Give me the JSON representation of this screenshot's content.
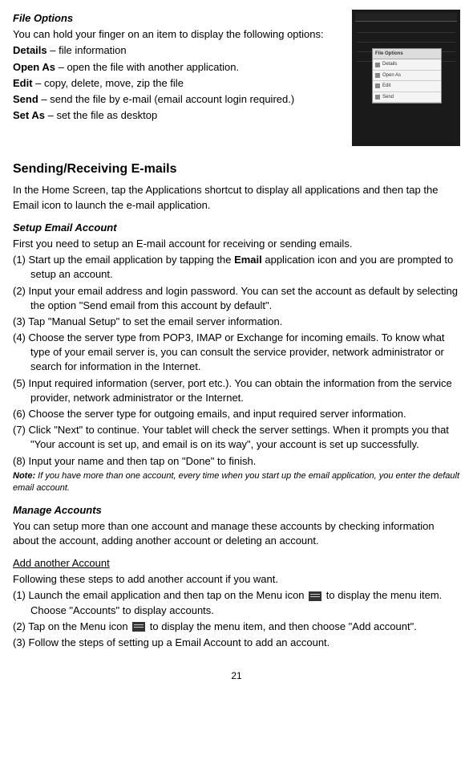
{
  "file_options": {
    "title": "File Options",
    "intro": "You can hold your finger on an item to display the following options:",
    "items": [
      {
        "term": "Details",
        "desc": " – file information"
      },
      {
        "term": "Open As",
        "desc": " – open the file with another application."
      },
      {
        "term": "Edit",
        "desc": " – copy, delete, move, zip the file"
      },
      {
        "term": "Send",
        "desc": " – send the file by e-mail (email account login required.)"
      },
      {
        "term": "Set As",
        "desc": " – set the file as desktop"
      }
    ]
  },
  "screenshot_popup": {
    "title": "File Options",
    "items": [
      "Details",
      "Open As",
      "Edit",
      "Send"
    ]
  },
  "sending": {
    "heading": "Sending/Receiving E-mails",
    "intro": "In the Home Screen, tap the Applications shortcut to display all applications and then tap the Email icon to launch the e-mail application."
  },
  "setup_email": {
    "title": "Setup Email Account",
    "intro": "First you need to setup an E-mail account for receiving or sending emails.",
    "steps": [
      {
        "prefix": "(1) Start up the email application by tapping the ",
        "bold": "Email",
        "suffix": " application icon and you are prompted to setup an account."
      },
      {
        "text": "(2) Input your email address and login password. You can set the account as default by selecting the option \"Send email from this account by default\"."
      },
      {
        "text": "(3) Tap \"Manual Setup\" to set the email server information."
      },
      {
        "text": "(4) Choose the server type from POP3, IMAP or Exchange for incoming emails. To know what type of your email server is, you can consult the service provider, network administrator or search for information in the Internet."
      },
      {
        "text": "(5) Input required information (server, port etc.). You can obtain the information from the service provider, network administrator or the Internet."
      },
      {
        "text": "(6) Choose the server type for outgoing emails, and input required server information."
      },
      {
        "text": "(7) Click \"Next\" to continue. Your tablet will check the server settings. When it prompts you that \"Your account is set up, and email is on its way\", your account is set up successfully."
      },
      {
        "text": "(8) Input your name and then tap on \"Done\" to finish."
      }
    ],
    "note_label": "Note:",
    "note_body": " If you have more than one account, every time when you start up the email application, you enter the default email account."
  },
  "manage_accounts": {
    "title": "Manage Accounts",
    "intro": "You can setup more than one account and manage these accounts by checking information about the account, adding another account or deleting an account."
  },
  "add_account": {
    "title": "Add another Account",
    "intro": "Following these steps to add another account if you want.",
    "step1_a": "(1) Launch the email application and then tap on the Menu icon ",
    "step1_b": " to display the menu item. Choose \"Accounts\" to display accounts.",
    "step2_a": "(2) Tap on the Menu icon ",
    "step2_b": " to display the menu item, and then choose \"Add account\".",
    "step3": "(3) Follow the steps of setting up a Email Account to add an account."
  },
  "page_number": "21"
}
